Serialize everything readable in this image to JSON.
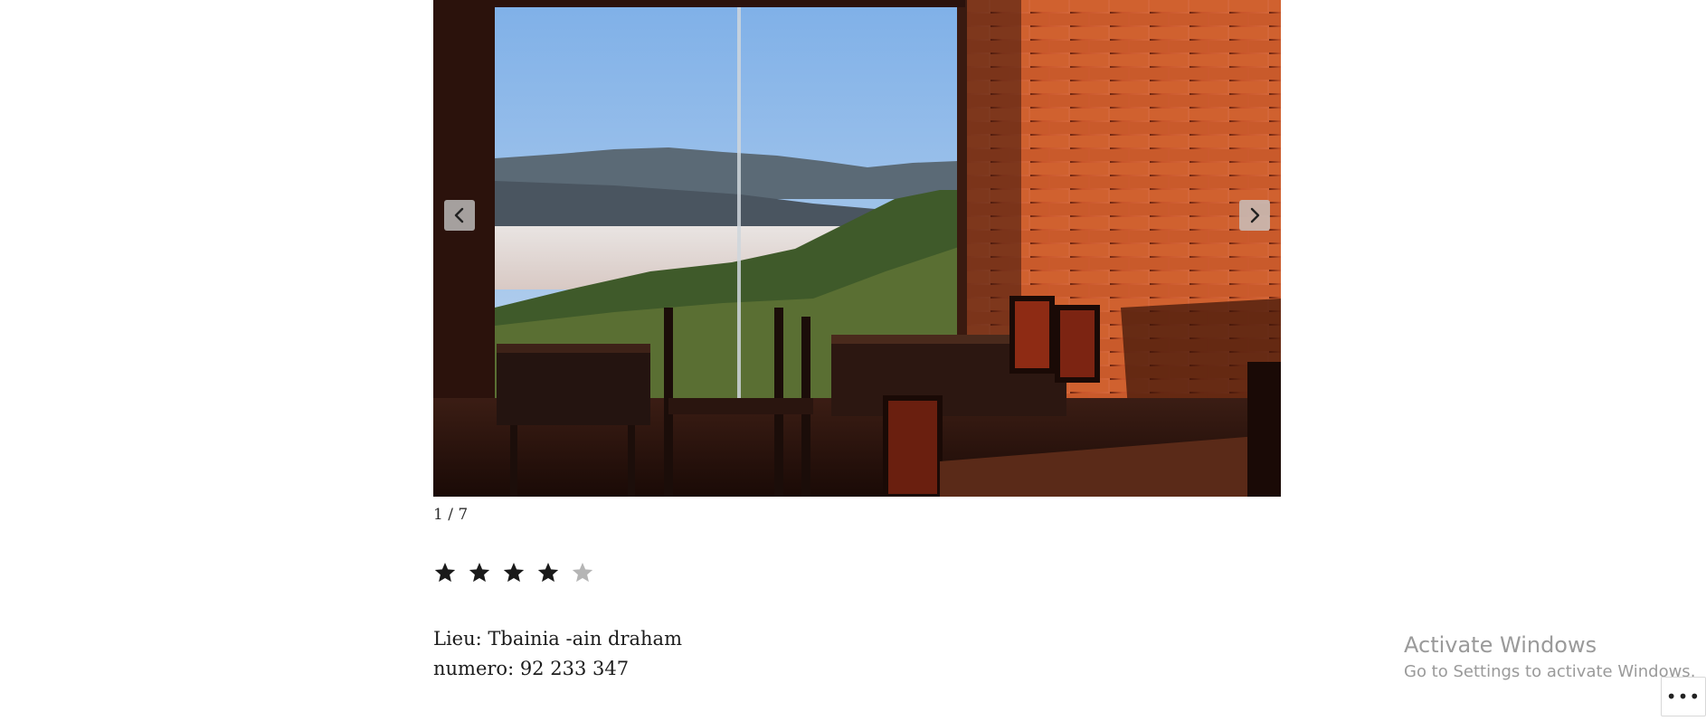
{
  "slideshow": {
    "counter": "1 / 7",
    "prev_icon": "chevron-left-icon",
    "next_icon": "chevron-right-icon"
  },
  "rating": {
    "value": 4,
    "max": 5,
    "filled_color": "#1a1a1a",
    "empty_color": "#b5b5b5"
  },
  "info": {
    "lieu": "Lieu: Tbainia -ain draham",
    "numero": "numero: 92 233 347"
  },
  "windows_watermark": {
    "title": "Activate Windows",
    "subtitle": "Go to Settings to activate Windows."
  },
  "more_button": {
    "label": "•••"
  }
}
